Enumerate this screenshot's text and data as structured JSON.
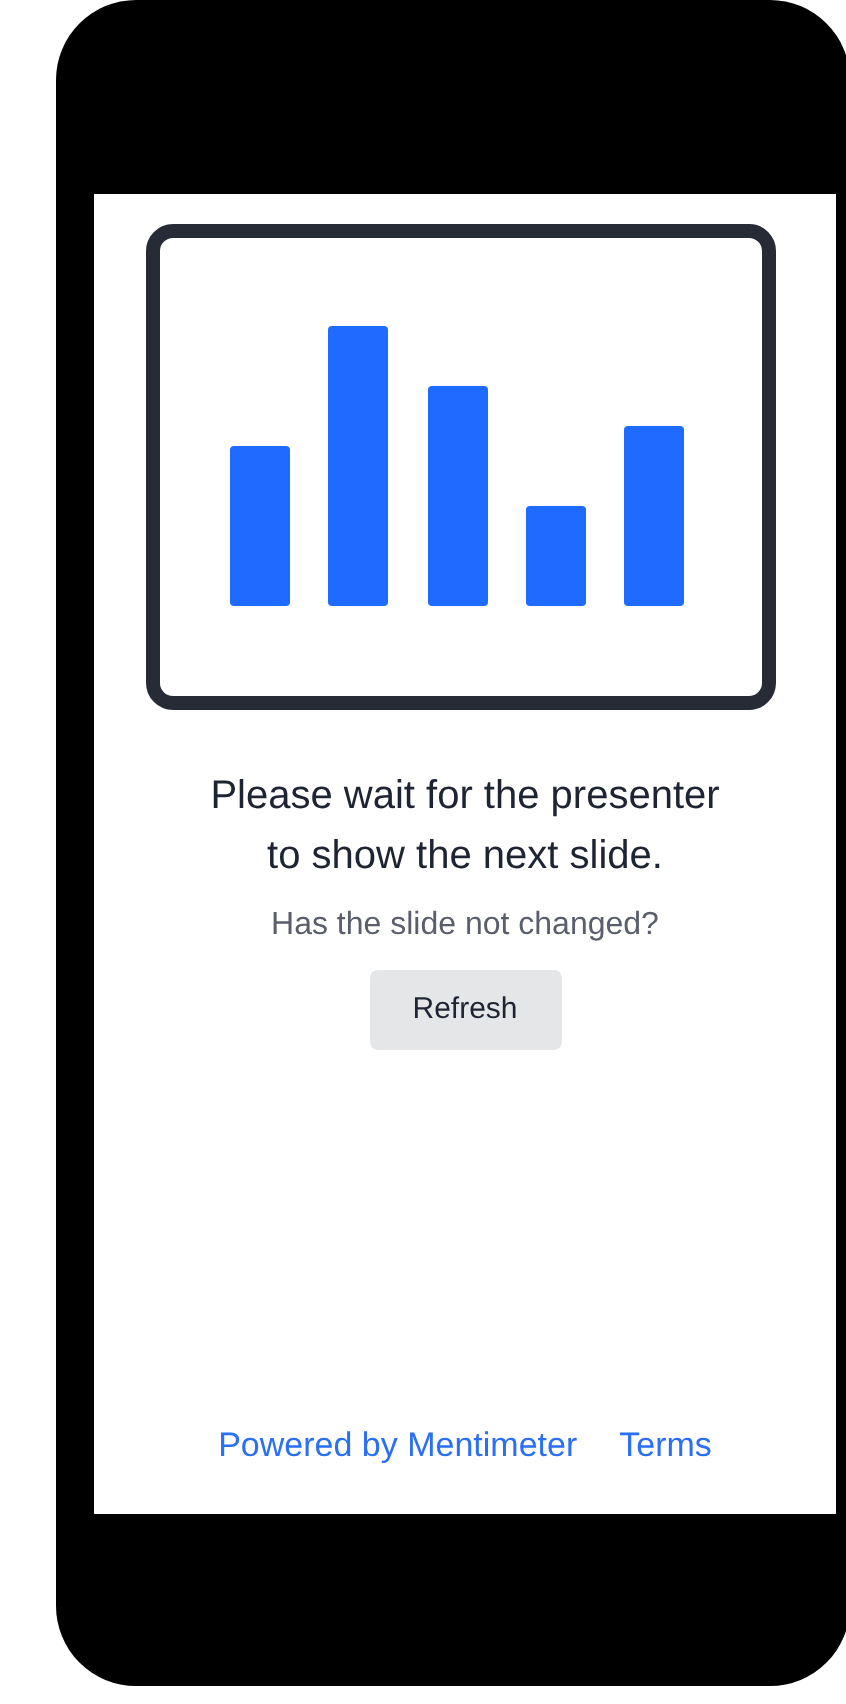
{
  "message": {
    "title": "Please wait for the presenter to show the next slide.",
    "question": "Has the slide not changed?",
    "button": "Refresh"
  },
  "footer": {
    "links": [
      "Powered by Mentimeter",
      "Terms"
    ]
  }
}
